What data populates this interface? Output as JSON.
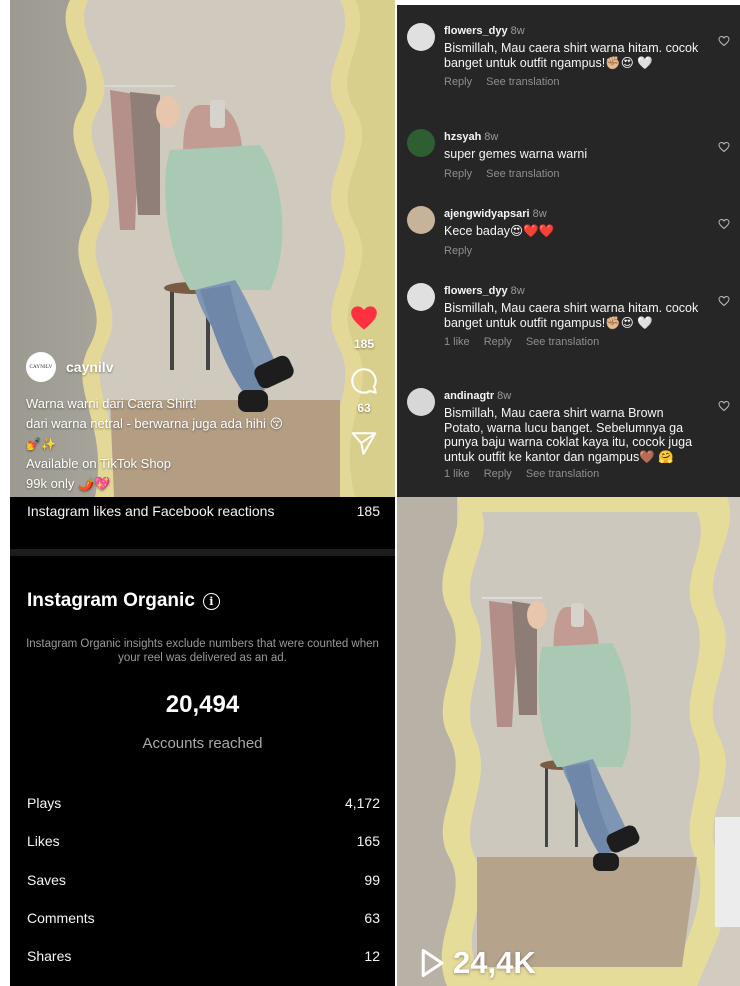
{
  "reel": {
    "author": "caynilv",
    "avatar_text": "CAYNILV",
    "caption_lines": [
      "Warna warni dari Caera Shirt!",
      "dari warna netral - berwarna juga ada hihi 😚",
      "💅✨",
      "Available on TikTok Shop",
      "99k only 🌶️💖"
    ],
    "like_count": "185",
    "comment_count": "63",
    "icons": [
      "heart-icon",
      "comment-icon",
      "share-icon"
    ]
  },
  "comments": [
    {
      "user": "flowers_dyy",
      "time": "8w",
      "text": "Bismillah, Mau caera shirt warna hitam. cocok banget untuk outfit ngampus!✊🏼😍 🤍",
      "meta": [
        "Reply",
        "See translation"
      ]
    },
    {
      "user": "hzsyah",
      "time": "8w",
      "text": "super gemes warna warni",
      "meta": [
        "Reply",
        "See translation"
      ]
    },
    {
      "user": "ajengwidyapsari",
      "time": "8w",
      "text": "Kece baday😍❤️❤️",
      "meta": [
        "Reply"
      ]
    },
    {
      "user": "flowers_dyy",
      "time": "8w",
      "text": "Bismillah, Mau caera shirt warna hitam. cocok banget untuk outfit ngampus!✊🏼😍 🤍",
      "meta": [
        "1 like",
        "Reply",
        "See translation"
      ]
    },
    {
      "user": "andinagtr",
      "time": "8w",
      "text": "Bismillah, Mau caera shirt warna Brown Potato, warna lucu banget. Sebelumnya ga punya baju warna coklat kaya itu, cocok juga untuk outfit ke kantor dan ngampus🤎 🤗",
      "meta": [
        "1 like",
        "Reply",
        "See translation"
      ]
    }
  ],
  "insights": {
    "likes_reactions_label": "Instagram likes and Facebook reactions",
    "likes_reactions_value": "185",
    "section_title": "Instagram Organic",
    "note": "Instagram Organic insights exclude numbers that were counted when your reel was delivered as an ad.",
    "accounts_reached_value": "20,494",
    "accounts_reached_label": "Accounts reached",
    "metrics": [
      {
        "label": "Plays",
        "value": "4,172"
      },
      {
        "label": "Likes",
        "value": "165"
      },
      {
        "label": "Saves",
        "value": "99"
      },
      {
        "label": "Comments",
        "value": "63"
      },
      {
        "label": "Shares",
        "value": "12"
      }
    ]
  },
  "thumbnail": {
    "play_count": "24,4K"
  },
  "colors": {
    "like_red": "#ff3040",
    "comments_bg": "#262626",
    "insights_bg": "#000000",
    "mirror_frame": "#e6dc9a"
  }
}
